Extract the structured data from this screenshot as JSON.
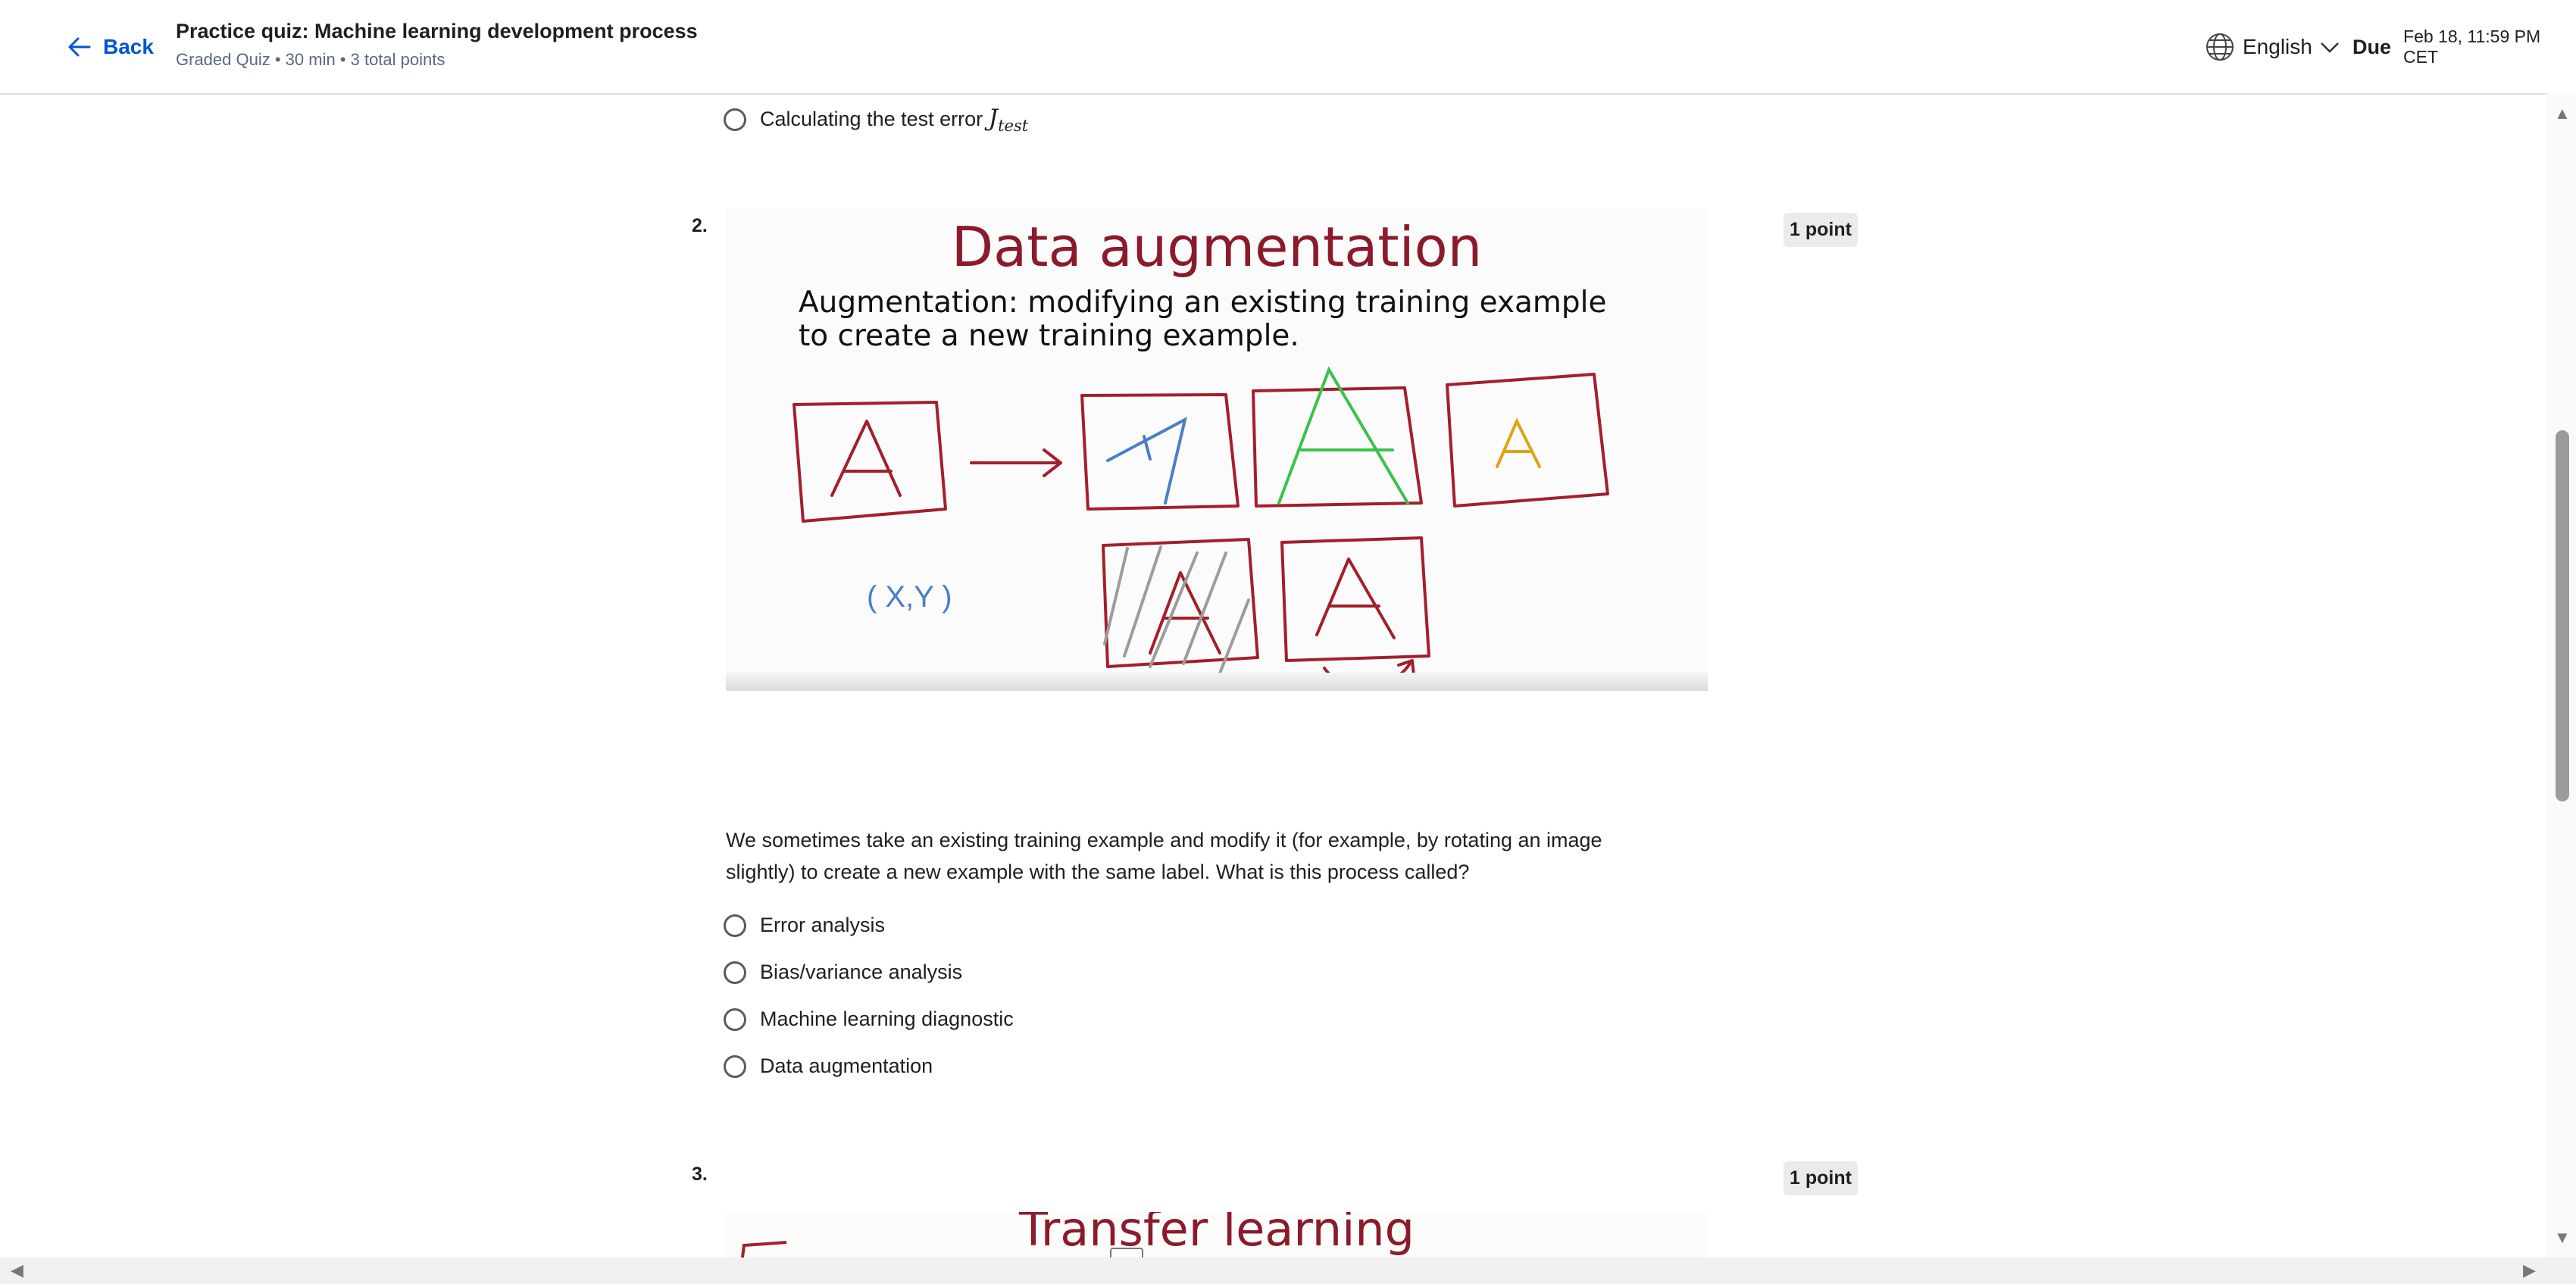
{
  "header": {
    "back_label": "Back",
    "title": "Practice quiz: Machine learning development process",
    "subtitle": "Graded Quiz • 30 min • 3 total points",
    "language": "English",
    "due_label": "Due",
    "due_value": "Feb 18, 11:59 PM CET"
  },
  "prev_option": {
    "label": "Calculating the test error",
    "math_symbol": "J",
    "math_subscript": "test"
  },
  "question2": {
    "number": "2.",
    "points": "1 point",
    "image": {
      "title": "Data augmentation",
      "subtitle": "Augmentation: modifying an existing training example to create a new training example.",
      "xy_label": "( X,Y )"
    },
    "text": "We sometimes take an existing training example and modify it (for example, by rotating an image slightly) to create a new example with the same label. What is this process called?",
    "options": [
      {
        "label": "Error analysis"
      },
      {
        "label": "Bias/variance analysis"
      },
      {
        "label": "Machine learning diagnostic"
      },
      {
        "label": "Data augmentation"
      }
    ]
  },
  "question3": {
    "number": "3.",
    "points": "1 point",
    "image_title": "Transfer learning"
  },
  "colors": {
    "link": "#0056d2",
    "slide_title": "#8b1a2b",
    "hand_red": "#a31f2c",
    "hand_blue": "#4a7fc8",
    "hand_green": "#3cc24a",
    "hand_yellow": "#e0a317"
  },
  "icons": [
    "arrow-left-icon",
    "globe-icon",
    "chevron-down-icon",
    "radio-icon"
  ]
}
